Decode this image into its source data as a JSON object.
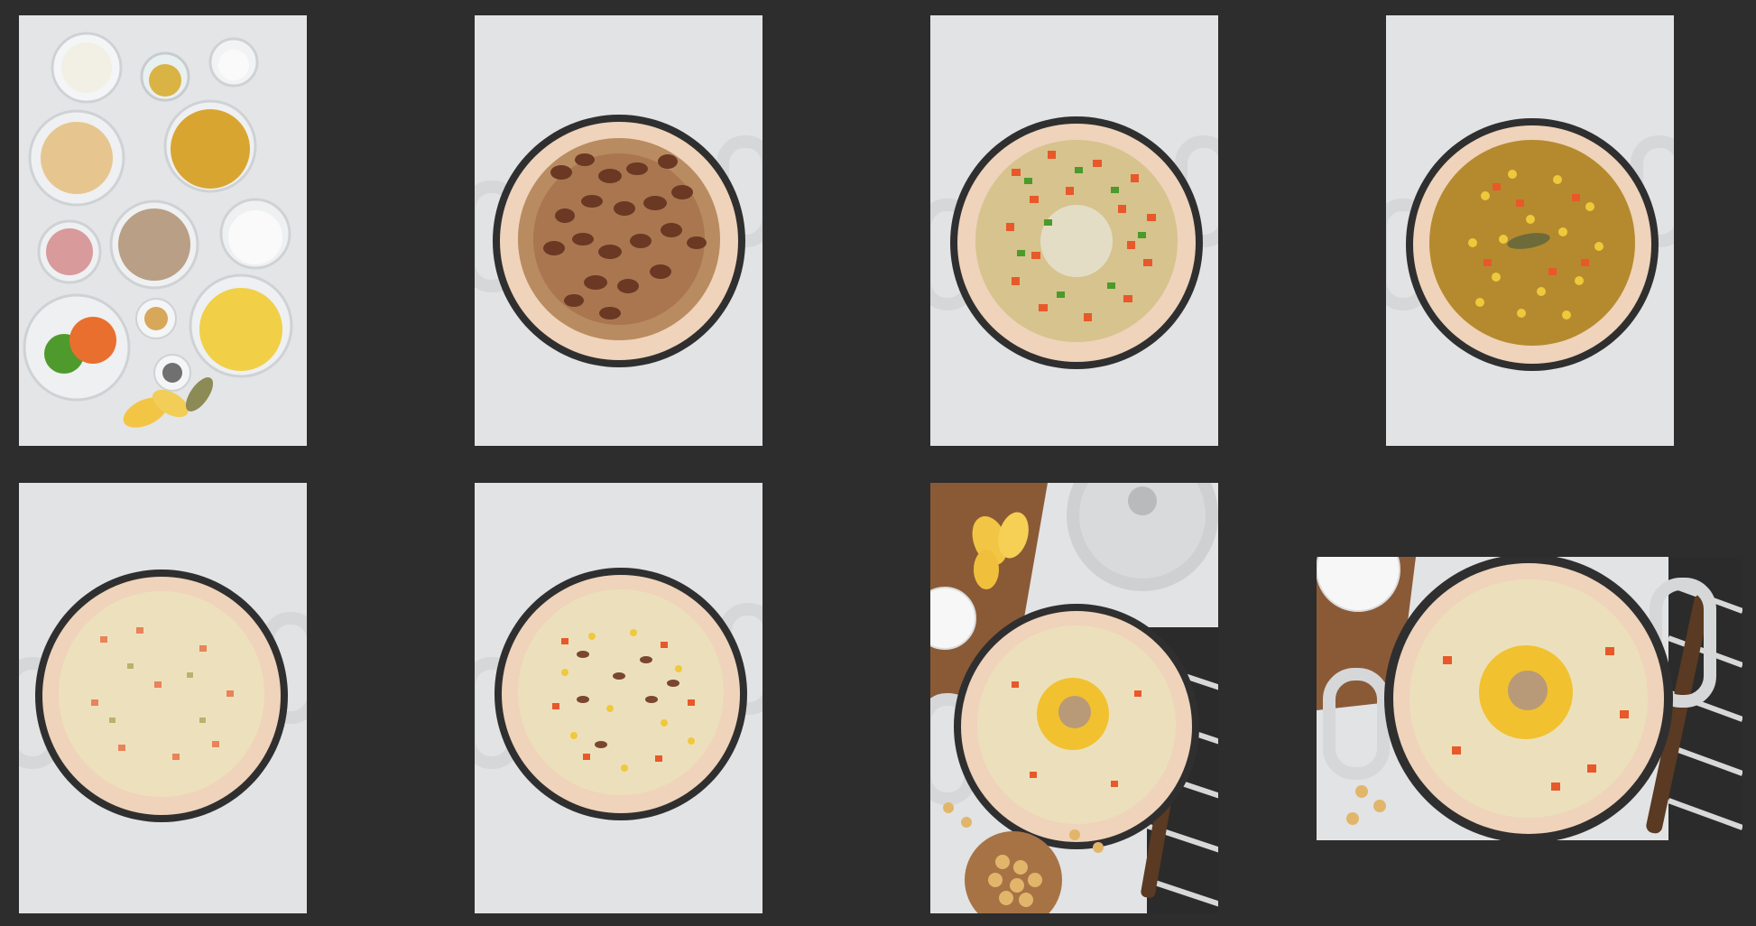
{
  "gallery": {
    "background_color": "#2d2d2d",
    "photos": [
      {
        "subject": "ingredients-in-prep-bowls"
      },
      {
        "subject": "pot-with-browned-bacon"
      },
      {
        "subject": "pot-with-sauteed-vegetables"
      },
      {
        "subject": "pot-with-broth-corn-and-bay-leaf"
      },
      {
        "subject": "pot-with-creamy-soup"
      },
      {
        "subject": "pot-with-creamy-soup-bacon-and-corn"
      },
      {
        "subject": "styled-chowder-with-lemons-crackers-and-lid"
      },
      {
        "subject": "close-up-finished-chowder"
      }
    ]
  }
}
